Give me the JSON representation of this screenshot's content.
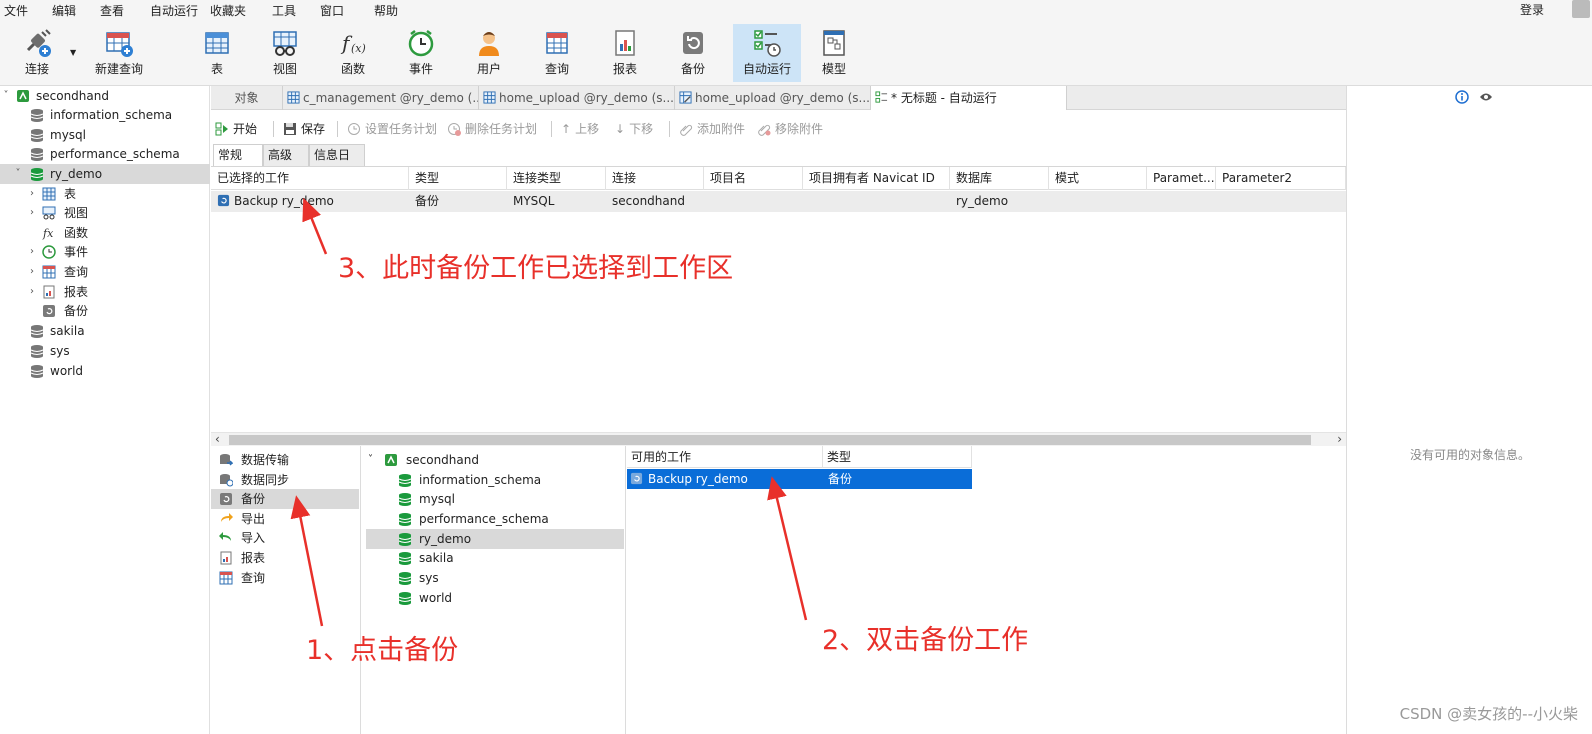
{
  "menu": [
    "文件",
    "编辑",
    "查看",
    "自动运行",
    "收藏夹",
    "工具",
    "窗口",
    "帮助"
  ],
  "login": "登录",
  "toolbar": {
    "connect": "连接",
    "new_query": "新建查询",
    "table": "表",
    "view": "视图",
    "function": "函数",
    "event": "事件",
    "user": "用户",
    "query": "查询",
    "report": "报表",
    "backup": "备份",
    "automation": "自动运行",
    "model": "模型"
  },
  "tree": {
    "connection": "secondhand",
    "dbs": [
      "information_schema",
      "mysql",
      "performance_schema",
      "ry_demo",
      "sakila",
      "sys",
      "world"
    ],
    "ry_children": [
      "表",
      "视图",
      "函数",
      "事件",
      "查询",
      "报表",
      "备份"
    ]
  },
  "tabs": [
    "对象",
    "c_management @ry_demo (...",
    "home_upload @ry_demo (s...",
    "home_upload @ry_demo (s...",
    "* 无标题 - 自动运行"
  ],
  "editor_toolbar": {
    "start": "开始",
    "save": "保存",
    "set_schedule": "设置任务计划",
    "delete_schedule": "删除任务计划",
    "move_up": "上移",
    "move_down": "下移",
    "add_attachment": "添加附件",
    "remove_attachment": "移除附件"
  },
  "subtabs": [
    "常规",
    "高级",
    "信息日志"
  ],
  "grid": {
    "headers": [
      "已选择的工作",
      "类型",
      "连接类型",
      "连接",
      "项目名",
      "项目拥有者 Navicat ID",
      "数据库",
      "模式",
      "Paramet...",
      "Parameter2"
    ],
    "row": [
      "Backup ry_demo",
      "备份",
      "MYSQL",
      "secondhand",
      "",
      "",
      "ry_demo",
      "",
      "",
      ""
    ]
  },
  "categories": [
    "数据传输",
    "数据同步",
    "备份",
    "导出",
    "导入",
    "报表",
    "查询"
  ],
  "objects": {
    "connection": "secondhand",
    "dbs": [
      "information_schema",
      "mysql",
      "performance_schema",
      "ry_demo",
      "sakila",
      "sys",
      "world"
    ]
  },
  "jobs": {
    "headers": [
      "可用的工作",
      "类型"
    ],
    "row": [
      "Backup ry_demo",
      "备份"
    ]
  },
  "info": {
    "empty": "没有可用的对象信息。"
  },
  "annotations": {
    "a1": "1、点击备份",
    "a2": "2、双击备份工作",
    "a3": "3、此时备份工作已选择到工作区"
  },
  "watermark": "CSDN @卖女孩的--小火柴",
  "colors": {
    "selection": "#0a6dd8",
    "annotation": "#e8302a",
    "db_icon": "#1a9a3c"
  }
}
